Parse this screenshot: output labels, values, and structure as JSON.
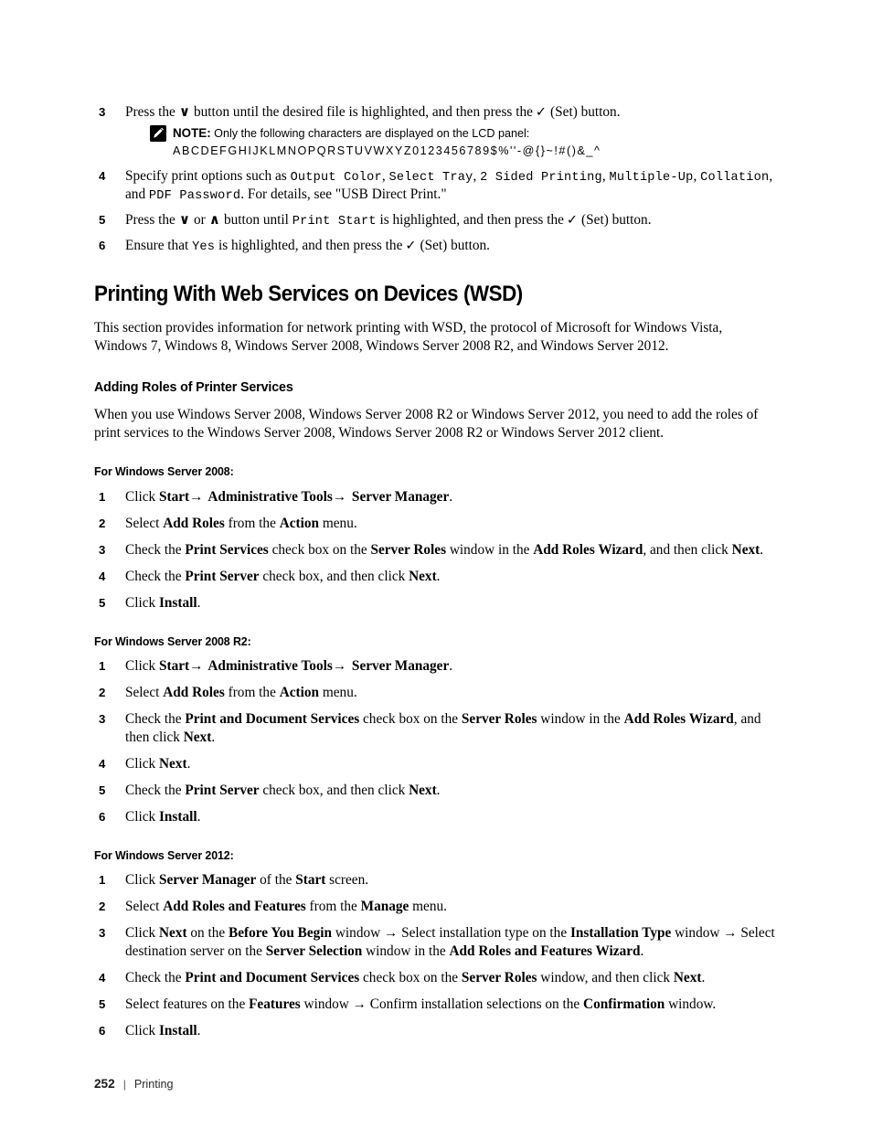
{
  "document": {
    "footer": {
      "page_number": "252",
      "separator": "|",
      "chapter": "Printing"
    }
  },
  "top_steps": {
    "step3": {
      "num": "3",
      "text_a": "Press the",
      "glyph_down": "∨",
      "text_b": "button until the desired file is highlighted, and then press the",
      "glyph_check": "✓",
      "text_c": "(Set) button."
    },
    "note": {
      "icon": "note-pencil-icon",
      "label": "NOTE:",
      "text": "Only the following characters are displayed on the LCD panel:",
      "characters": "ABCDEFGHIJKLMNOPQRSTUVWXYZ0123456789$%''-@{}~!#()&_^"
    },
    "step4": {
      "num": "4",
      "text_a": "Specify print options such as",
      "mono1": "Output Color",
      "sep1": ",",
      "mono2": "Select Tray",
      "sep2": ",",
      "mono3": "2 Sided Printing",
      "sep3": ",",
      "mono4": "Multiple-Up",
      "sep4": ",",
      "mono5": "Collation",
      "text_b": ", and",
      "mono6": "PDF Password",
      "text_c": ". For details, see \"USB Direct Print.\""
    },
    "step5": {
      "num": "5",
      "text_a": "Press the",
      "glyph_down": "∨",
      "text_or": "or",
      "glyph_up": "∧",
      "text_b": "button until",
      "mono1": "Print Start",
      "text_c": "is highlighted, and then press the",
      "glyph_check": "✓",
      "text_d": "(Set) button."
    },
    "step6": {
      "num": "6",
      "text_a": "Ensure that",
      "mono1": "Yes",
      "text_b": "is highlighted, and then press the",
      "glyph_check": "✓",
      "text_c": "(Set) button."
    }
  },
  "section": {
    "title": "Printing With Web Services on Devices (WSD)",
    "intro": "This section provides information for network printing with WSD, the protocol of Microsoft for Windows Vista, Windows 7, Windows 8, Windows Server 2008, Windows Server 2008 R2, and Windows Server 2012.",
    "subsection": {
      "title": "Adding Roles of Printer Services",
      "intro": "When you use Windows Server 2008, Windows Server 2008 R2 or Windows Server 2012, you need to add the roles of print services to the Windows Server 2008, Windows Server 2008 R2 or Windows Server 2012 client."
    }
  },
  "server2008": {
    "heading": "For Windows Server 2008:",
    "steps": {
      "s1": {
        "num": "1",
        "a": "Click ",
        "b1": "Start",
        "arrow1": "→",
        "b2": " Administrative Tools",
        "arrow2": "→",
        "b3": " Server Manager",
        "c": "."
      },
      "s2": {
        "num": "2",
        "a": "Select ",
        "b1": "Add Roles",
        "b": " from the ",
        "b2": "Action",
        "c": " menu."
      },
      "s3": {
        "num": "3",
        "a": "Check the ",
        "b1": "Print Services",
        "b": " check box on the ",
        "b2": "Server Roles",
        "c": " window in the ",
        "b3": "Add Roles Wizard",
        "d": ", and then click ",
        "b4": "Next",
        "e": "."
      },
      "s4": {
        "num": "4",
        "a": "Check the ",
        "b1": "Print Server",
        "b": " check box, and then click ",
        "b2": "Next",
        "c": "."
      },
      "s5": {
        "num": "5",
        "a": "Click ",
        "b1": "Install",
        "b": "."
      }
    }
  },
  "server2008r2": {
    "heading": "For Windows Server 2008 R2:",
    "steps": {
      "s1": {
        "num": "1",
        "a": "Click ",
        "b1": "Start",
        "arrow1": "→",
        "b2": " Administrative Tools",
        "arrow2": "→",
        "b3": " Server Manager",
        "c": "."
      },
      "s2": {
        "num": "2",
        "a": "Select ",
        "b1": "Add Roles",
        "b": " from the ",
        "b2": "Action",
        "c": " menu."
      },
      "s3": {
        "num": "3",
        "a": "Check the ",
        "b1": "Print and Document Services",
        "b": " check box on the ",
        "b2": "Server Roles",
        "c": " window in the ",
        "b3": "Add Roles Wizard",
        "d": ", and then click ",
        "b4": "Next",
        "e": "."
      },
      "s4": {
        "num": "4",
        "a": "Click ",
        "b1": "Next",
        "b": "."
      },
      "s5": {
        "num": "5",
        "a": "Check the ",
        "b1": "Print Server",
        "b": " check box, and then click ",
        "b2": "Next",
        "c": "."
      },
      "s6": {
        "num": "6",
        "a": "Click ",
        "b1": "Install",
        "b": "."
      }
    }
  },
  "server2012": {
    "heading": "For Windows Server 2012:",
    "steps": {
      "s1": {
        "num": "1",
        "a": "Click ",
        "b1": "Server Manager",
        "b": " of the ",
        "b2": "Start",
        "c": " screen."
      },
      "s2": {
        "num": "2",
        "a": "Select ",
        "b1": "Add Roles and Features",
        "b": " from the ",
        "b2": "Manage",
        "c": " menu."
      },
      "s3": {
        "num": "3",
        "a": "Click ",
        "b1": "Next",
        "b": " on the ",
        "b2": "Before You Begin",
        "c": " window ",
        "arrow1": "→",
        "d": " Select installation type on the ",
        "b3": "Installation Type",
        "e": " window ",
        "arrow2": "→",
        "f": " Select destination server on the ",
        "b4": "Server Selection",
        "g": " window in the ",
        "b5": "Add Roles and Features Wizard",
        "h": "."
      },
      "s4": {
        "num": "4",
        "a": "Check the ",
        "b1": "Print and Document Services",
        "b": " check box on the ",
        "b2": "Server Roles",
        "c": " window, and then click ",
        "b3": "Next",
        "d": "."
      },
      "s5": {
        "num": "5",
        "a": "Select features on the ",
        "b1": "Features",
        "b": " window ",
        "arrow1": "→",
        "c": " Confirm installation selections on the ",
        "b2": "Confirmation",
        "d": " window."
      },
      "s6": {
        "num": "6",
        "a": "Click ",
        "b1": "Install",
        "b": "."
      }
    }
  }
}
